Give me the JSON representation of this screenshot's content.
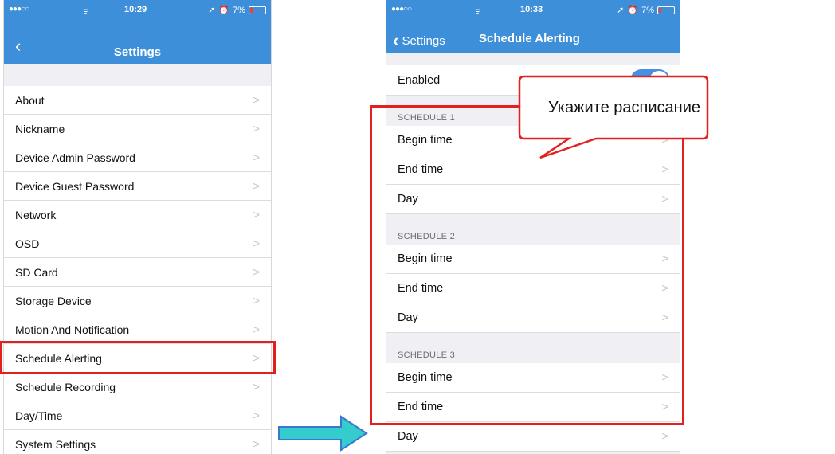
{
  "phone_left": {
    "status": {
      "signal": "●●●○○",
      "wifi": "ᯤ",
      "time": "10:29",
      "location_icon": "location-icon",
      "alarm_icon": "alarm-icon",
      "battery": "7%"
    },
    "nav": {
      "back_icon": "chevron-left-icon",
      "title": "Settings"
    },
    "items": [
      {
        "label": "About"
      },
      {
        "label": "Nickname"
      },
      {
        "label": "Device Admin Password"
      },
      {
        "label": "Device Guest Password"
      },
      {
        "label": "Network"
      },
      {
        "label": "OSD"
      },
      {
        "label": "SD Card"
      },
      {
        "label": "Storage Device"
      },
      {
        "label": "Motion And Notification"
      },
      {
        "label": "Schedule Alerting"
      },
      {
        "label": "Schedule Recording"
      },
      {
        "label": "Day/Time"
      },
      {
        "label": "System Settings"
      }
    ],
    "chevron": ">",
    "highlighted_item": "Schedule Alerting"
  },
  "phone_right": {
    "status": {
      "signal": "●●●○○",
      "wifi": "ᯤ",
      "time": "10:33",
      "location_icon": "location-icon",
      "alarm_icon": "alarm-icon",
      "battery": "7%"
    },
    "nav": {
      "back_label": "Settings",
      "back_icon": "chevron-left-icon",
      "title": "Schedule Alerting"
    },
    "enabled": {
      "label": "Enabled",
      "value": true
    },
    "schedules": [
      {
        "header": "SCHEDULE 1",
        "rows": [
          {
            "label": "Begin time"
          },
          {
            "label": "End time"
          },
          {
            "label": "Day"
          }
        ]
      },
      {
        "header": "SCHEDULE 2",
        "rows": [
          {
            "label": "Begin time"
          },
          {
            "label": "End time"
          },
          {
            "label": "Day"
          }
        ]
      },
      {
        "header": "SCHEDULE 3",
        "rows": [
          {
            "label": "Begin time"
          },
          {
            "label": "End time"
          },
          {
            "label": "Day"
          }
        ]
      }
    ],
    "chevron": ">"
  },
  "annotation": {
    "callout_text": "Укажите расписание",
    "arrow_icon": "right-arrow-icon",
    "colors": {
      "highlight": "#e32020",
      "arrow_fill": "#34cccc",
      "arrow_stroke": "#3a78d0",
      "navbar": "#3d8fd9",
      "toggle": "#4a90e2"
    }
  }
}
